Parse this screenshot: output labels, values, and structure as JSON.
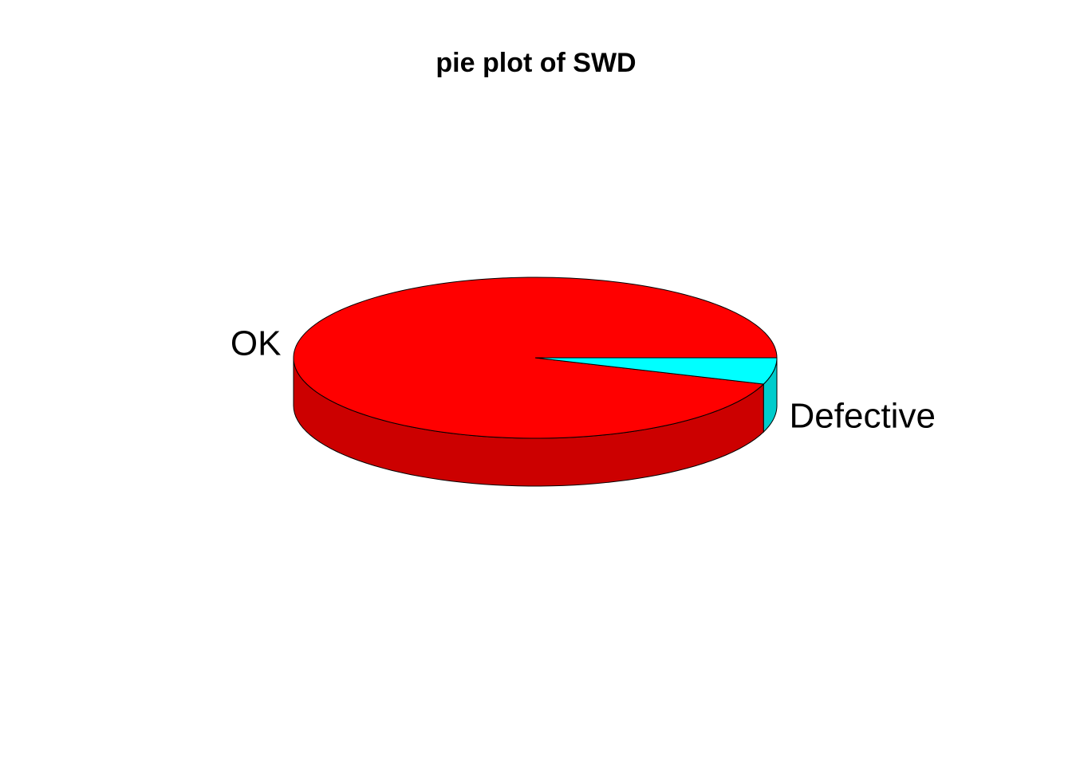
{
  "chart_data": {
    "type": "pie",
    "style": "3d",
    "title": "pie plot of SWD",
    "slices": [
      {
        "label": "OK",
        "value": 0.947,
        "color": "#FF0000",
        "side_color": "#CC0000"
      },
      {
        "label": "Defective",
        "value": 0.053,
        "color": "#00FFFF",
        "side_color": "#00CCCC"
      }
    ],
    "start_angle_deg": 0,
    "direction": "counterclockwise"
  }
}
